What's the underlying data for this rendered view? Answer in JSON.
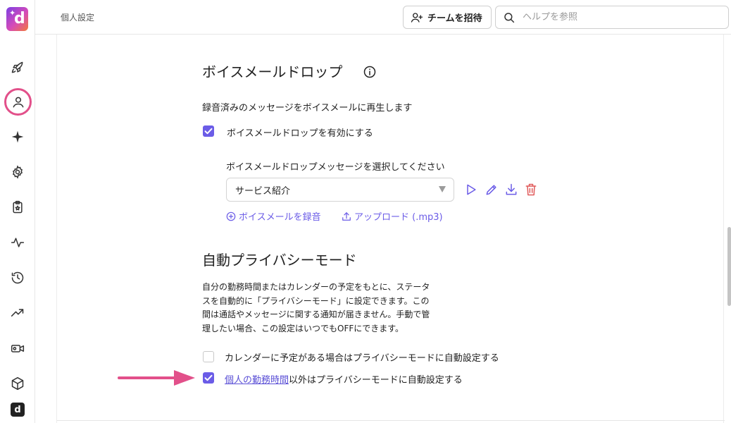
{
  "topbar": {
    "breadcrumb": "個人設定",
    "invite_label": "チームを招待",
    "search_placeholder": "ヘルプを参照"
  },
  "sidebar": {
    "logo_letter": "d",
    "icons": [
      "rocket-icon",
      "user-icon",
      "sparkle-icon",
      "gear-icon",
      "clipboard-icon",
      "activity-icon",
      "history-icon",
      "trend-icon",
      "video-icon",
      "box-icon",
      "app-icon"
    ],
    "bottom_app_letter": "d"
  },
  "voicemail": {
    "title": "ボイスメールドロップ",
    "description": "録音済みのメッセージをボイスメールに再生します",
    "enable_label": "ボイスメールドロップを有効にする",
    "enable_checked": true,
    "select_label": "ボイスメールドロップメッセージを選択してください",
    "selected_message": "サービス紹介",
    "record_link": "ボイスメールを録音",
    "upload_link": "アップロード (.mp3)"
  },
  "privacy": {
    "title": "自動プライバシーモード",
    "description": [
      "自分の勤務時間またはカレンダーの予定をもとに、ステータ",
      "スを自動的に「プライバシーモード」に設定できます。この",
      "間は通話やメッセージに関する通知が届きません。手動で管",
      "理したい場合、この設定はいつでもOFFにできます。"
    ],
    "calendar_label": "カレンダーに予定がある場合はプライバシーモードに自動設定する",
    "calendar_checked": false,
    "hours_link": "個人の勤務時間",
    "hours_label_rest": "以外はプライバシーモードに自動設定する",
    "hours_checked": true
  },
  "colors": {
    "accent": "#6b5ce7",
    "annotation_arrow": "#e2508a",
    "delete": "#e05a5a"
  }
}
